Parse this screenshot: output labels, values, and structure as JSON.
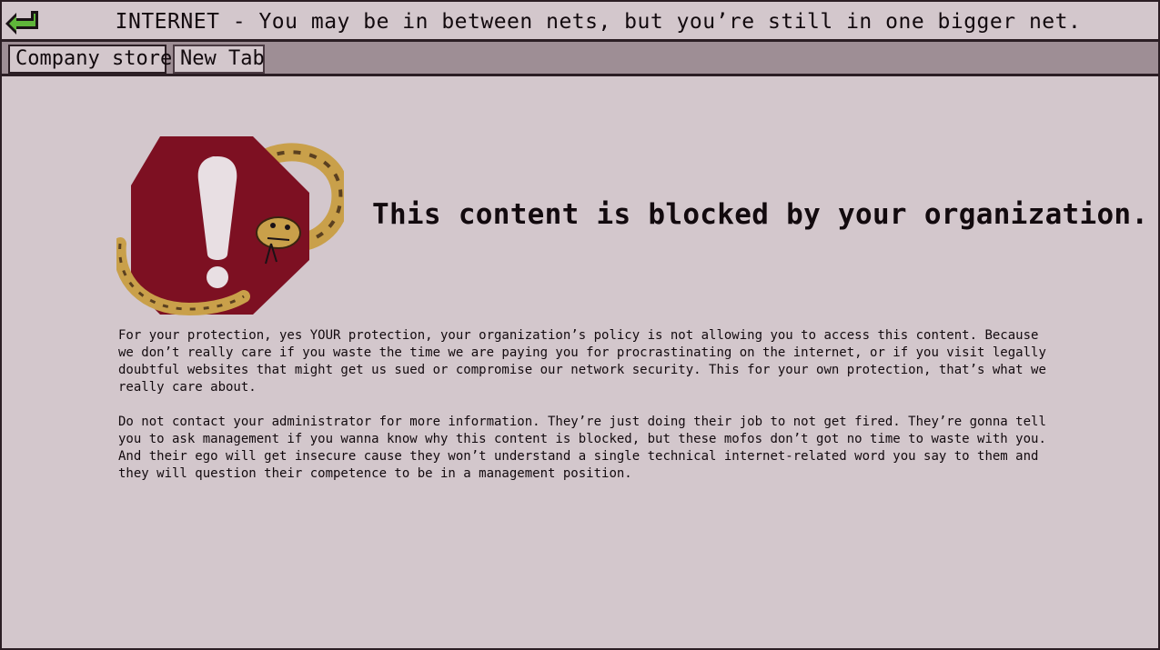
{
  "window": {
    "title": "INTERNET - You may be in between nets, but you’re still in one bigger net."
  },
  "icons": {
    "back": "back-arrow-icon",
    "blocked": "stop-sign-exclamation-snake-icon"
  },
  "tabs": [
    {
      "label": "Company store",
      "active": true
    },
    {
      "label": "New Tab",
      "active": false
    }
  ],
  "page": {
    "headline": "This content is blocked by your organization.",
    "paragraphs": [
      "For your protection, yes YOUR protection, your organization’s policy is not allowing you to access this content. Because we don’t really care if you waste the time we are paying you for procrastinating on the internet, or if you visit legally doubtful websites that might get us sued or compromise our network security. This for your own protection, that’s what we really care about.",
      "Do not contact your administrator for more information. They’re just doing their job to not get fired. They’re gonna tell you to ask management if you wanna know why this content is blocked, but these mofos don’t got no time to waste with you. And their ego will get insecure cause they won’t understand a single technical internet-related word you say to them and they will question their competence to be in a management position."
    ]
  },
  "colors": {
    "background": "#d3c7cc",
    "tabbar": "#9e8e95",
    "border": "#2b1e24",
    "stop_sign": "#7d1022",
    "back_arrow": "#5fb53a"
  }
}
